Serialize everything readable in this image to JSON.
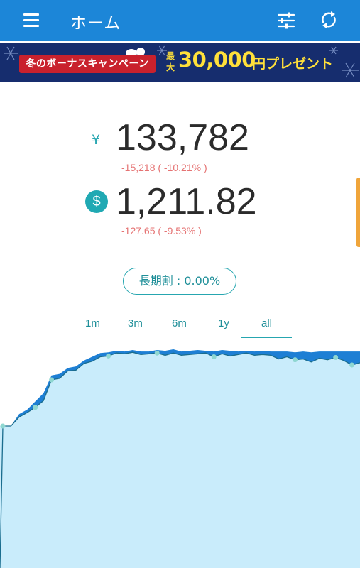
{
  "appbar": {
    "title": "ホーム",
    "menu_icon": "hamburger-menu-icon",
    "filter_icon": "tune-sliders-icon",
    "sync_icon": "sync-icon"
  },
  "banner": {
    "campaign": "冬のボーナスキャンペーン",
    "prefix": "最大",
    "amount": "30,000",
    "suffix": "円プレゼント",
    "colors": {
      "background": "#162d6e",
      "ribbon": "#c9212d",
      "text": "#ffe03a"
    }
  },
  "balances": {
    "yen": {
      "symbol": "¥",
      "value": "133,782",
      "change": "-15,218 ( -10.21% )"
    },
    "usd": {
      "symbol": "$",
      "value": "1,211.82",
      "change": "-127.65 ( -9.53% )"
    }
  },
  "discount_button": {
    "label": "長期割 : 0.00%"
  },
  "range_tabs": [
    {
      "label": "1m",
      "active": false
    },
    {
      "label": "3m",
      "active": false
    },
    {
      "label": "6m",
      "active": false
    },
    {
      "label": "1y",
      "active": false
    },
    {
      "label": "all",
      "active": true
    }
  ],
  "colors": {
    "primary": "#1c86d8",
    "accent": "#26a6b0",
    "negative": "#e57373",
    "chart_fill": "#c9ecfb",
    "chart_line": "#1a6d8e",
    "chart_gain": "#1e7fd4"
  },
  "chart_data": {
    "type": "area",
    "xlabel": "",
    "ylabel": "",
    "series": [
      {
        "values": [
          0,
          0,
          1.2,
          1.8,
          2.5,
          3.4,
          6.2,
          6.4,
          7.4,
          7.5,
          8.4,
          8.7,
          9.3,
          9.4,
          9.8,
          9.7,
          9.9,
          9.6,
          9.7,
          9.8,
          9.5,
          9.8,
          9.5,
          9.6,
          9.7,
          9.8,
          9.3,
          9.7,
          9.4,
          9.6,
          9.8,
          9.5,
          9.6,
          9.5,
          9.0,
          9.3,
          8.9,
          9.0,
          8.6,
          9.1,
          8.9,
          9.2,
          8.8,
          8.2,
          8.5
        ]
      },
      {
        "values": [
          0,
          0,
          1.6,
          2.2,
          3.3,
          4.4,
          6.8,
          7.0,
          7.8,
          8.0,
          8.8,
          9.3,
          9.8,
          9.9,
          10.1,
          10.0,
          10.2,
          10.0,
          10.0,
          10.2,
          10.1,
          10.3,
          10.0,
          10.1,
          10.2,
          10.1,
          10.0,
          10.2,
          10.1,
          10.0,
          10.1,
          10.0,
          10.1,
          10.0,
          10.0,
          10.0,
          9.9,
          10.0,
          9.9,
          10.0,
          10.0,
          10.0,
          10.0,
          10.0,
          10.0
        ]
      }
    ]
  }
}
